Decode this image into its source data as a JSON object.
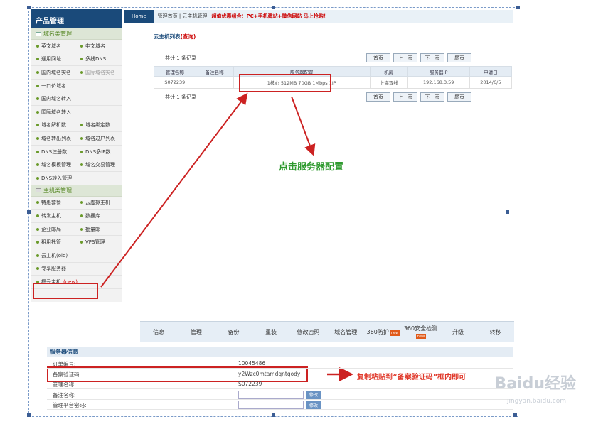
{
  "sidebar": {
    "title": "产品管理",
    "domain_section": "域名类管理",
    "domain_rows": [
      [
        {
          "label": "英文域名"
        },
        {
          "label": "中文域名"
        }
      ],
      [
        {
          "label": "通用网址"
        },
        {
          "label": "多线DNS"
        }
      ],
      [
        {
          "label": "国内域名实名"
        },
        {
          "label": "国际域名实名",
          "muted": true
        }
      ],
      [
        {
          "label": "一口价域名"
        }
      ],
      [
        {
          "label": "国内域名转入"
        }
      ],
      [
        {
          "label": "国际域名转入"
        }
      ],
      [
        {
          "label": "域名解析数"
        },
        {
          "label": "域名绑定数"
        }
      ],
      [
        {
          "label": "域名转出列表"
        },
        {
          "label": "域名过户列表"
        }
      ],
      [
        {
          "label": "DNS注册数"
        },
        {
          "label": "DNS多IP数"
        }
      ],
      [
        {
          "label": "域名模板管理"
        },
        {
          "label": "域名交易管理"
        }
      ],
      [
        {
          "label": "DNS转入管理"
        }
      ]
    ],
    "host_section": "主机类管理",
    "host_rows": [
      [
        {
          "label": "特惠套餐"
        },
        {
          "label": "云虚拟主机"
        }
      ],
      [
        {
          "label": "转发主机"
        },
        {
          "label": "数据库"
        }
      ],
      [
        {
          "label": "企业邮局"
        },
        {
          "label": "批量邮"
        }
      ],
      [
        {
          "label": "租用托管"
        },
        {
          "label": "VPS管理"
        }
      ],
      [
        {
          "label": "云主机(old)"
        }
      ],
      [
        {
          "label": "专享服务器"
        }
      ]
    ],
    "highlight_item": "框云主机",
    "highlight_new": "(new)"
  },
  "topbar": {
    "home": "Home",
    "breadcrumb": "管理首页 | 云主机管理",
    "promo": "超值优惠组合：PC+手机建站+微信网站 马上抢购！"
  },
  "cloud_list": {
    "title": "云主机列表",
    "title_link": "(查询)",
    "records": "共计 1 条记录",
    "pager": [
      "首页",
      "上一页",
      "下一页",
      "尾页"
    ],
    "columns": [
      "管理名称",
      "备注名称",
      "服务器配置",
      "机房",
      "服务器IP",
      "申请日"
    ],
    "rows": [
      [
        "S072239",
        "",
        "1核心 512MB 70GB 1Mbps 1IP",
        "上海双线",
        "192.168.3.59",
        "2014/6/5"
      ]
    ]
  },
  "annotations": {
    "click_config": "点击服务器配置",
    "copy_paste": "复制粘贴到“备案验证码”框内即可"
  },
  "tabs": [
    {
      "label": "信息"
    },
    {
      "label": "管理"
    },
    {
      "label": "备份"
    },
    {
      "label": "重装"
    },
    {
      "label": "修改密码"
    },
    {
      "label": "域名管理"
    },
    {
      "label": "360防护",
      "badge": "new"
    },
    {
      "label": "360安全检测",
      "badge": "new"
    },
    {
      "label": "升级"
    },
    {
      "label": "转移"
    }
  ],
  "server_info": {
    "title": "服务器信息",
    "rows": [
      {
        "label": "订单编号:",
        "value": "10045486"
      },
      {
        "label": "备案验证码:",
        "value": "y2Wzc0mtamdqntqody"
      },
      {
        "label": "管理名称:",
        "value": "S072239"
      },
      {
        "label": "备注名称:",
        "button": "修改"
      },
      {
        "label": "管理平台密码:",
        "button": "修改"
      }
    ]
  },
  "watermark": {
    "brand": "Baidu经验",
    "url": "jingyan.baidu.com"
  }
}
